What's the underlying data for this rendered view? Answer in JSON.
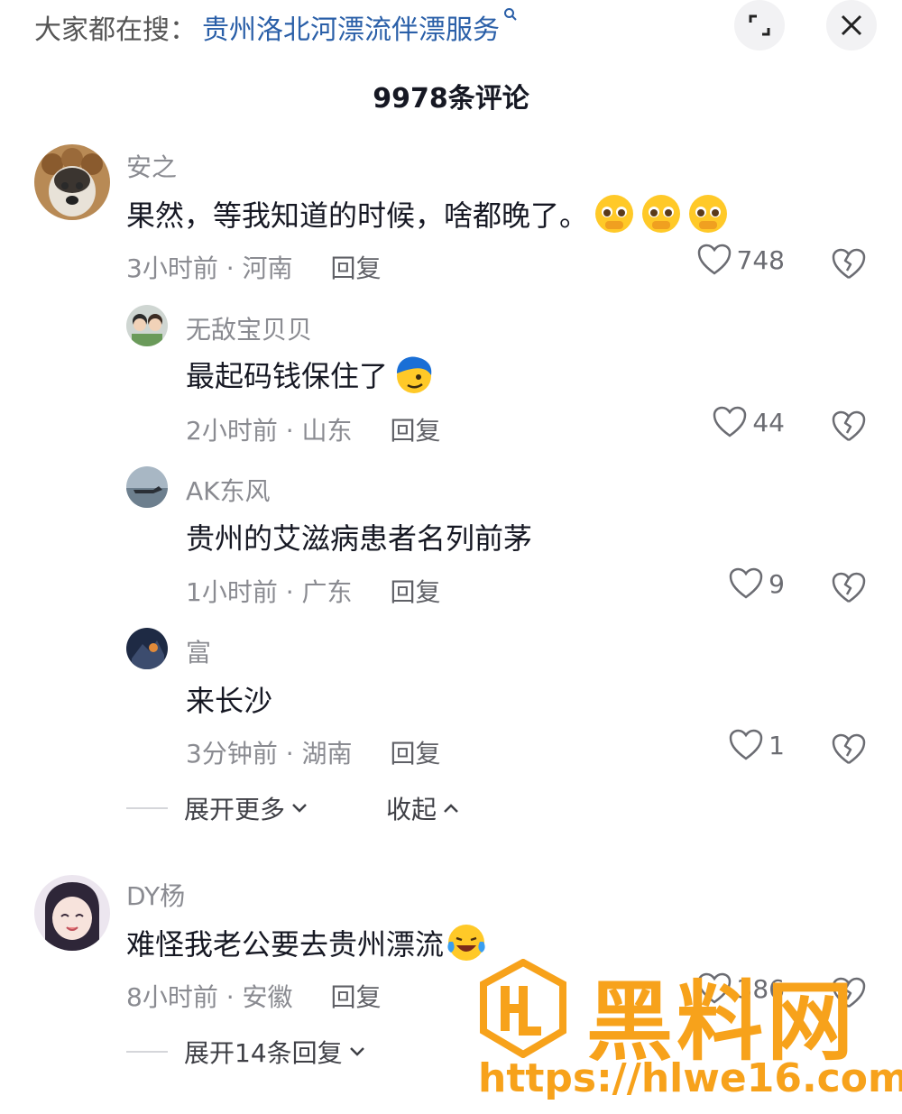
{
  "header": {
    "search_prefix": "大家都在搜：",
    "search_term": "贵州洛北河漂流伴漂服务",
    "comment_count_title": "9978条评论"
  },
  "comments": [
    {
      "user": "安之",
      "text": "果然，等我知道的时候，啥都晚了。",
      "meta": "3小时前 · 河南",
      "reply": "回复",
      "likes": "748",
      "emojis": [
        "pleading-face",
        "pleading-face",
        "pleading-face"
      ],
      "replies": [
        {
          "user": "无敌宝贝贝",
          "text": "最起码钱保住了",
          "meta": "2小时前 · 山东",
          "reply": "回复",
          "likes": "44",
          "emoji": "sly-face"
        },
        {
          "user": "AK东风",
          "text": "贵州的艾滋病患者名列前茅",
          "meta": "1小时前 · 广东",
          "reply": "回复",
          "likes": "9"
        },
        {
          "user": "富",
          "text": "来长沙",
          "meta": "3分钟前 · 湖南",
          "reply": "回复",
          "likes": "1"
        }
      ],
      "expand_more": "展开更多",
      "collapse": "收起"
    },
    {
      "user": "DY杨",
      "text": "难怪我老公要去贵州漂流",
      "meta": "8小时前 · 安徽",
      "reply": "回复",
      "likes": "386",
      "emoji": "crying-laughing-face",
      "expand_replies": "展开14条回复"
    }
  ],
  "watermark": {
    "brand": "黑料网",
    "url": "https://hlwe16.com",
    "color": "#f7a21b"
  }
}
